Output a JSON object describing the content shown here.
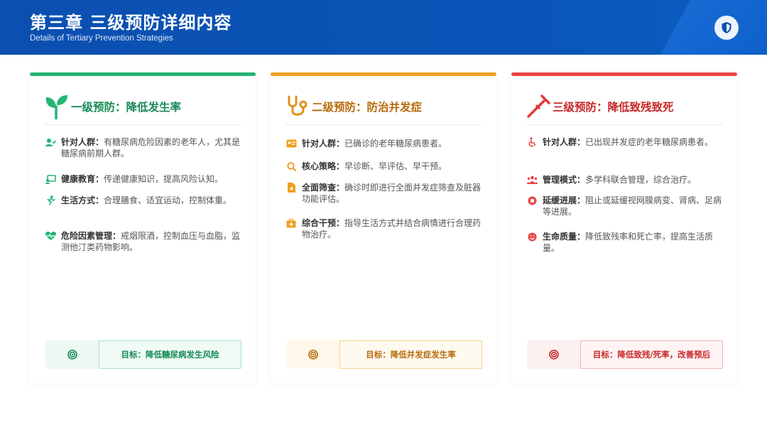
{
  "header": {
    "title": "第三章 三级预防详细内容",
    "subtitle": "Details of Tertiary Prevention Strategies",
    "badge_icon": "shield-icon"
  },
  "colors": {
    "primary_blue": "#0b4fb0",
    "green": "#22b573",
    "orange": "#f0a020",
    "red": "#e84545"
  },
  "cards": [
    {
      "title": "一级预防：降低发生率",
      "icon": "sprout-icon",
      "items": [
        {
          "label": "针对人群：",
          "text": "有糖尿病危险因素的老年人，尤其是糖尿病前期人群。",
          "icon": "user-check-icon"
        },
        {
          "label": "健康教育：",
          "text": "传递健康知识，提高风险认知。",
          "icon": "chalkboard-icon"
        },
        {
          "label": "生活方式：",
          "text": "合理膳食、适宜运动，控制体重。",
          "icon": "running-icon"
        },
        {
          "label": "危险因素管理：",
          "text": "戒烟限酒，控制血压与血脂，监测他汀类药物影响。",
          "icon": "heartbeat-icon"
        }
      ],
      "goal": "目标：降低糖尿病发生风险",
      "goal_icon": "target-icon"
    },
    {
      "title": "二级预防：防治并发症",
      "icon": "stethoscope-icon",
      "items": [
        {
          "label": "针对人群：",
          "text": "已确诊的老年糖尿病患者。",
          "icon": "id-card-icon"
        },
        {
          "label": "核心策略：",
          "text": "早诊断、早评估、早干预。",
          "icon": "search-icon"
        },
        {
          "label": "全面筛查：",
          "text": "确诊时即进行全面并发症筛查及脏器功能评估。",
          "icon": "file-medical-icon"
        },
        {
          "label": "综合干预：",
          "text": "指导生活方式并结合病情进行合理药物治疗。",
          "icon": "medkit-icon"
        }
      ],
      "goal": "目标：降低并发症发生率",
      "goal_icon": "target-icon"
    },
    {
      "title": "三级预防：降低致残致死",
      "icon": "crutch-icon",
      "items": [
        {
          "label": "针对人群：",
          "text": "已出现并发症的老年糖尿病患者。",
          "icon": "wheelchair-icon"
        },
        {
          "label": "管理模式：",
          "text": "多学科联合管理，综合治疗。",
          "icon": "team-icon"
        },
        {
          "label": "延缓进展：",
          "text": "阻止或延缓视网膜病变、肾病、足病等进展。",
          "icon": "stop-icon"
        },
        {
          "label": "生命质量：",
          "text": "降低致残率和死亡率，提高生活质量。",
          "icon": "smile-icon"
        }
      ],
      "goal": "目标：降低致残/死率，改善预后",
      "goal_icon": "target-icon"
    }
  ]
}
